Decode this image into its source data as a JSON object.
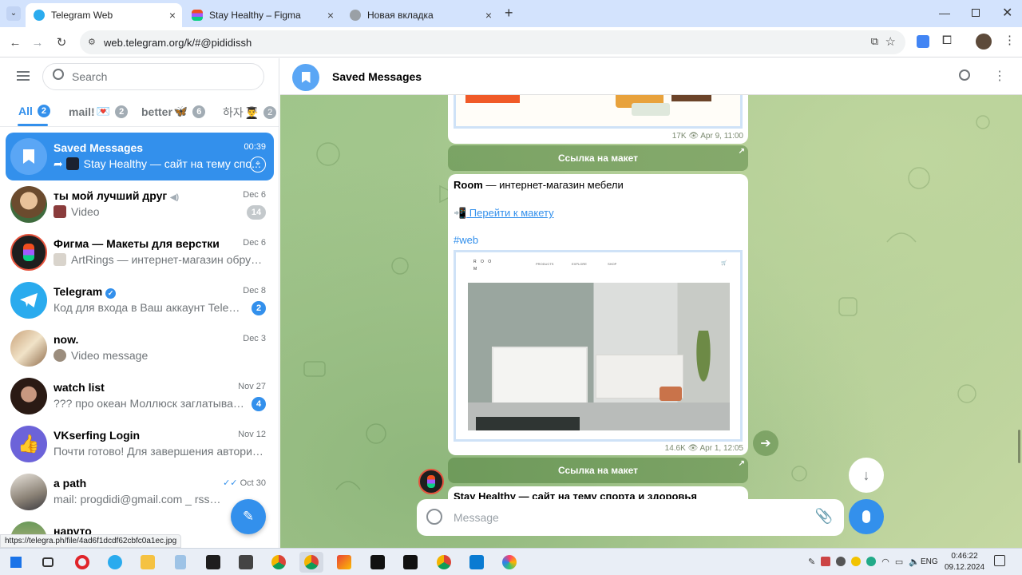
{
  "browser": {
    "tabs": [
      {
        "title": "Telegram Web",
        "active": true
      },
      {
        "title": "Stay Healthy – Figma",
        "active": false
      },
      {
        "title": "Новая вкладка",
        "active": false
      }
    ],
    "new_tab": "+",
    "url": "web.telegram.org/k/#@pididissh",
    "status_url": "https://telegra.ph/file/4ad6f1dcdf62cbfc0a1ec.jpg"
  },
  "sidebar": {
    "search_placeholder": "Search",
    "filters": [
      {
        "label": "All",
        "icon": "",
        "count": "2",
        "active": true
      },
      {
        "label": "mail!",
        "icon": "💌",
        "count": "2",
        "active": false
      },
      {
        "label": "better",
        "icon": "🦋",
        "count": "6",
        "active": false
      },
      {
        "label": "하자",
        "icon": "👨‍🎓",
        "count": "2",
        "active": false
      }
    ],
    "chats": [
      {
        "name": "Saved Messages",
        "preview": "Stay Healthy — сайт на тему спо...",
        "date": "00:39",
        "badge": "",
        "active": true
      },
      {
        "name": "ты мой лучший друг",
        "preview": "Video",
        "date": "Dec 6",
        "badge": "14",
        "muted": true
      },
      {
        "name": "Фигма — Макеты для верстки",
        "preview": "ArtRings — интернет-магазин обручал...",
        "date": "Dec 6",
        "badge": ""
      },
      {
        "name": "Telegram",
        "preview": "Код для входа в Ваш аккаунт Telegra...",
        "date": "Dec 8",
        "badge": "2"
      },
      {
        "name": "now.",
        "preview": "Video message",
        "date": "Dec 3",
        "badge": ""
      },
      {
        "name": "watch list",
        "preview": "??? про океан Моллюск заглатывает...",
        "date": "Nov 27",
        "badge": "4"
      },
      {
        "name": "VKserfing Login",
        "preview": "Почти готово! Для завершения авториза...",
        "date": "Nov 12",
        "badge": ""
      },
      {
        "name": "a path",
        "preview": "mail: progdidi@gmail.com _ rssschool",
        "date": "Oct 30",
        "badge": ""
      },
      {
        "name": "наруто",
        "preview": "",
        "date": "",
        "badge": ""
      }
    ]
  },
  "chat": {
    "title": "Saved Messages",
    "msg1": {
      "views": "17K",
      "time": "Apr 9, 11:00",
      "button": "Ссылка на макет"
    },
    "msg2": {
      "title_bold": "Room",
      "title_rest": " — интернет-магазин мебели",
      "link_emoji": "📲",
      "link": " Перейти к макету",
      "hashtag": "#web",
      "preview_nav": [
        "PRODUCTS",
        "EXPLORE",
        "SHOP"
      ],
      "preview_logo": "R O O M",
      "views": "14.6K",
      "time": "Apr 1, 12:05",
      "button": "Ссылка на макет"
    },
    "msg3_title": "Stay Healthy — сайт на тему спорта и здоровья",
    "composer_placeholder": "Message"
  },
  "taskbar": {
    "lang": "ENG",
    "time": "0:46:22",
    "date": "09.12.2024"
  },
  "colors": {
    "accent": "#3390ec",
    "chrome_tabs": "#d3e3fd",
    "chat_bg": "#a9c891"
  }
}
